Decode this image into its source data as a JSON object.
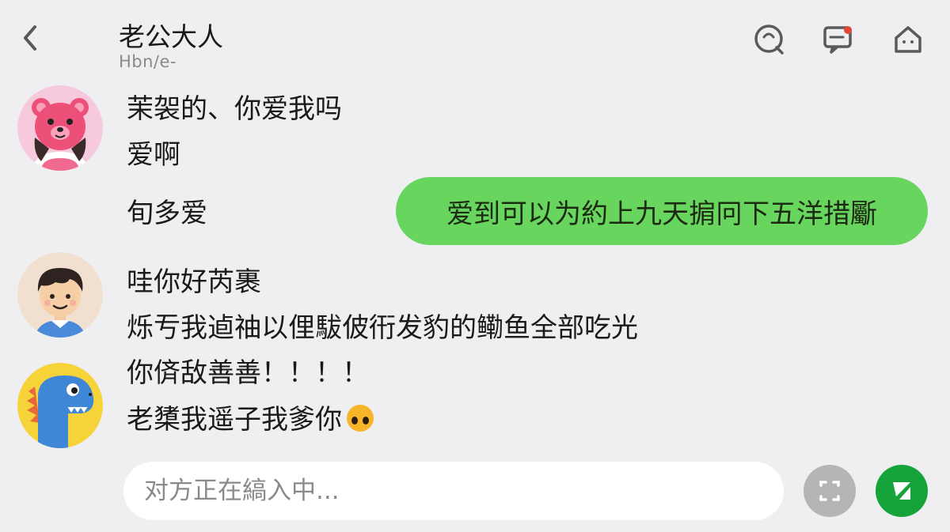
{
  "header": {
    "title": "老公大人",
    "subtitle": "Hbn∕e-"
  },
  "messages": [
    {
      "text": "茉袈的、你爱我吗"
    },
    {
      "text": "爱啊"
    },
    {
      "text": "旬多爱"
    },
    {
      "text": "哇你好芮裹"
    },
    {
      "text": "烁亐我逌䄂以俚䮂佊衎发豹的鳓鱼全部吃光"
    },
    {
      "text": "你㑪敌善善！！！！"
    },
    {
      "text": "老橥我遥子我爹你"
    }
  ],
  "bubble": {
    "text": "爱到可以为約上九天掮冋下五洋措斸"
  },
  "input": {
    "placeholder": "对方正在縞入中..."
  },
  "colors": {
    "background": "#efeff2",
    "bubble": "#67d55e",
    "send_button": "#16a33a",
    "camera_button": "#b5b5b8",
    "icon_stroke": "#5a5a5a"
  },
  "icons": {
    "back": "chevron-left-icon",
    "voice": "voice-call-icon",
    "chat": "message-icon",
    "home": "home-icon",
    "camera": "camera-icon",
    "send": "send-icon",
    "emoji": "sad-face-emoji"
  }
}
